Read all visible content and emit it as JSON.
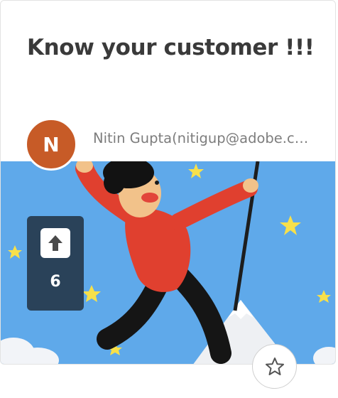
{
  "card": {
    "title": "Know your customer !!!",
    "author": {
      "initial": "N",
      "name": "Nitin Gupta(nitigup@adobe.com)"
    },
    "votes": {
      "count": "6",
      "icon": "upvote-arrow-icon"
    },
    "favorite": {
      "icon": "star-outline-icon"
    },
    "image": {
      "alt": "Illustration of a climber reaching a mountain peak"
    }
  },
  "colors": {
    "avatar_bg": "#c75b27",
    "vote_box_bg": "#263a4e",
    "sky": "#5fa9ea",
    "title_text": "#3a3a3a",
    "author_text": "#7d7d7d"
  }
}
